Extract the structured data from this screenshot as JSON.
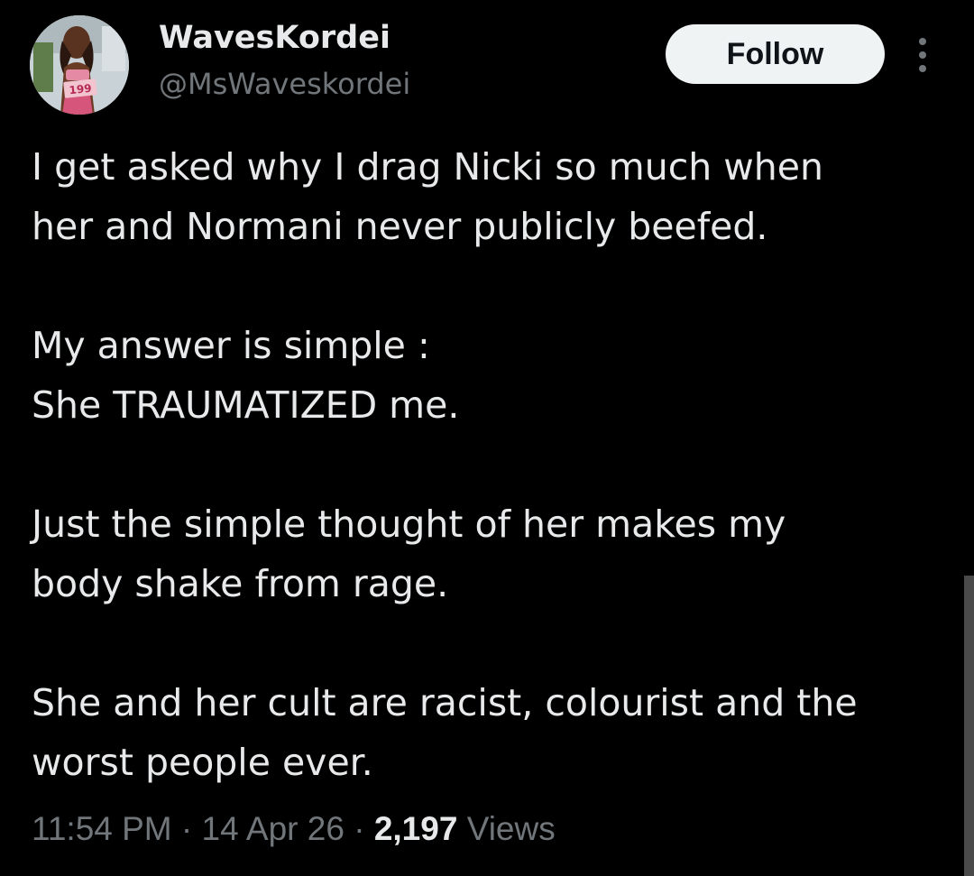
{
  "tweet": {
    "author": {
      "display_name": "WavesKordei",
      "handle": "@MsWaveskordei",
      "avatar_text": "199"
    },
    "follow_label": "Follow",
    "more_icon": "more-vertical-icon",
    "paragraphs": [
      [
        "I get asked why  I drag Nicki so much when",
        "her and Normani never publicly beefed."
      ],
      [
        "My answer is simple :",
        "She TRAUMATIZED me."
      ],
      [
        "Just the simple thought of her makes my",
        "body shake from rage."
      ],
      [
        "She and her cult are racist, colourist and the",
        "worst people ever."
      ]
    ],
    "meta": {
      "time": "11:54 PM",
      "separator": "·",
      "date": "14 Apr 26",
      "views_count": "2,197",
      "views_label": "Views"
    }
  },
  "colors": {
    "background": "#000000",
    "text_primary": "#e7e9ea",
    "text_secondary": "#71767b",
    "button_bg": "#eff3f4",
    "button_text": "#0f1419",
    "scrollbar": "#4a4a4a"
  }
}
